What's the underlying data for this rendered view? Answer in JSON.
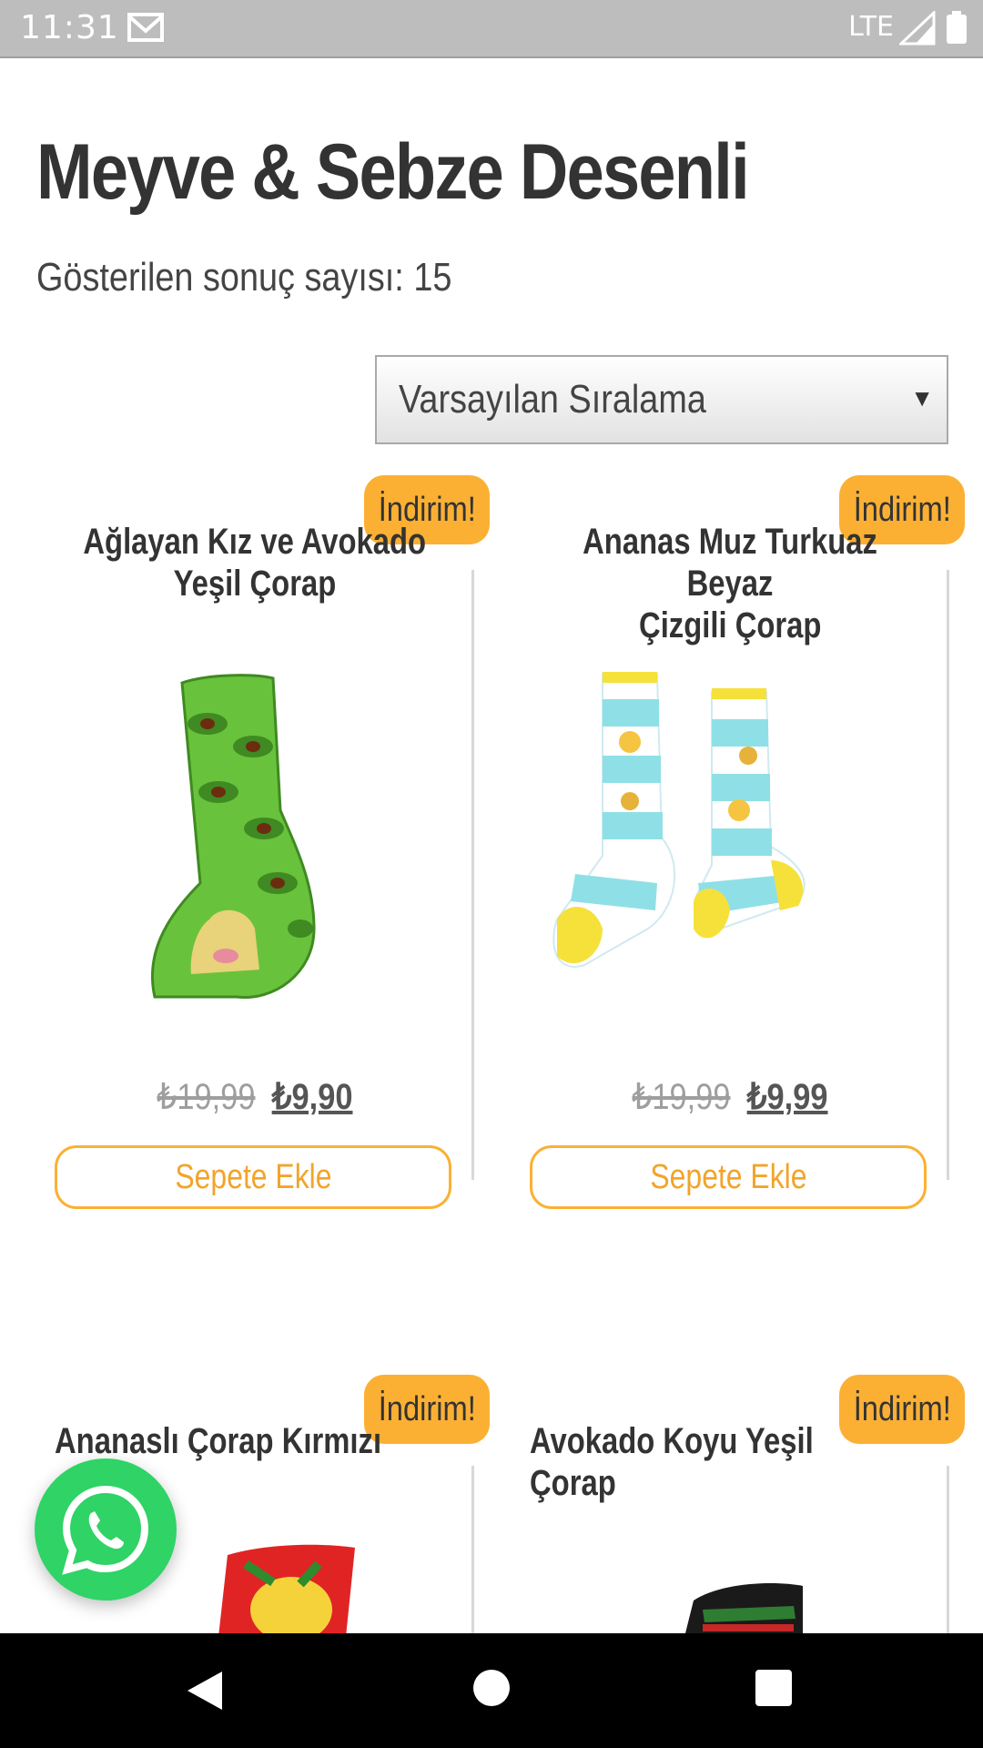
{
  "status_bar": {
    "time": "11:31",
    "network": "LTE",
    "icons": [
      "mail-icon",
      "signal-icon",
      "battery-icon"
    ]
  },
  "page": {
    "title": "Meyve & Sebze Desenli",
    "result_count": "Gösterilen sonuç sayısı: 15"
  },
  "sort": {
    "selected": "Varsayılan Sıralama",
    "icon": "dropdown-arrow-icon"
  },
  "products": [
    {
      "badge": "İndirim!",
      "title_line1": "Ağlayan Kız ve Avokado",
      "title_line2": "Yeşil Çorap",
      "old_price": "₺19,99",
      "new_price": "₺9,90",
      "button": "Sepete Ekle"
    },
    {
      "badge": "İndirim!",
      "title_line1": "Ananas Muz Turkuaz Beyaz",
      "title_line2": "Çizgili Çorap",
      "old_price": "₺19,99",
      "new_price": "₺9,99",
      "button": "Sepete Ekle"
    },
    {
      "badge": "İndirim!",
      "title_line1": "Ananaslı Çorap Kırmızı"
    },
    {
      "badge": "İndirim!",
      "title_line1": "Avokado Koyu Yeşil Çorap"
    }
  ],
  "floating": {
    "icon": "whatsapp-icon"
  },
  "nav": {
    "icons": [
      "back-icon",
      "home-icon",
      "recents-icon"
    ]
  },
  "colors": {
    "accent": "#fbb034",
    "whatsapp": "#2fd366",
    "title": "#333333"
  }
}
